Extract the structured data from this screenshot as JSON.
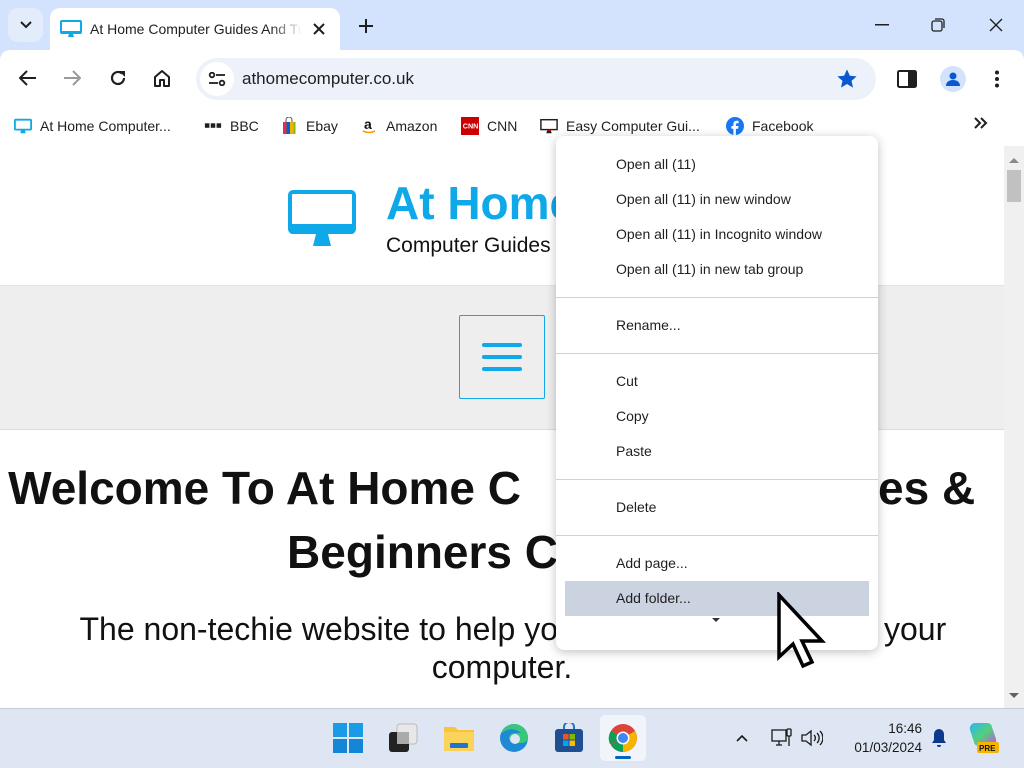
{
  "browser": {
    "tab": {
      "title": "At Home Computer Guides And Tutorials",
      "favicon": "monitor-icon"
    },
    "new_tab_label": "+",
    "window_controls": [
      "minimize",
      "restore",
      "close"
    ],
    "address": {
      "url": "athomecomputer.co.uk",
      "bookmarked": true
    },
    "accent": "#0b57d0"
  },
  "bookmarks": {
    "items": [
      {
        "label": "At Home Computer...",
        "icon": "monitor-icon"
      },
      {
        "label": "BBC",
        "icon": "bbc-icon"
      },
      {
        "label": "Ebay",
        "icon": "shopping-bag-icon"
      },
      {
        "label": "Amazon",
        "icon": "amazon-icon"
      },
      {
        "label": "CNN",
        "icon": "cnn-icon"
      },
      {
        "label": "Easy Computer Gui...",
        "icon": "monitor-icon"
      },
      {
        "label": "Facebook",
        "icon": "facebook-icon"
      }
    ],
    "overflow_label": "»"
  },
  "page": {
    "brand": "At Home",
    "tagline": "Computer Guides",
    "brand_color": "#0fa8e8",
    "headline": "Welcome To At Home Computer Guides & Beginners Courses",
    "subheadline": "The non-techie website to help you get the most from your computer.",
    "headline_visible_left_1": "Welcome To At Home C",
    "headline_visible_right_1": "es &",
    "headline_visible_left_2": "Beginners C",
    "sub_visible_left_1": "The non-techie website to help yo",
    "sub_visible_right_1": "your",
    "sub_visible_2": "computer."
  },
  "context_menu": {
    "groups": [
      [
        "Open all (11)",
        "Open all (11) in new window",
        "Open all (11) in Incognito window",
        "Open all (11) in new tab group"
      ],
      [
        "Rename..."
      ],
      [
        "Cut",
        "Copy",
        "Paste"
      ],
      [
        "Delete"
      ],
      [
        "Add page...",
        "Add folder..."
      ]
    ],
    "highlighted": "Add folder..."
  },
  "taskbar": {
    "apps": [
      "Start",
      "Task View",
      "File Explorer",
      "Microsoft Edge",
      "Microsoft Store",
      "Google Chrome"
    ],
    "active_app": "Google Chrome",
    "time": "16:46",
    "date": "01/03/2024",
    "copilot_badge": "PRE"
  }
}
